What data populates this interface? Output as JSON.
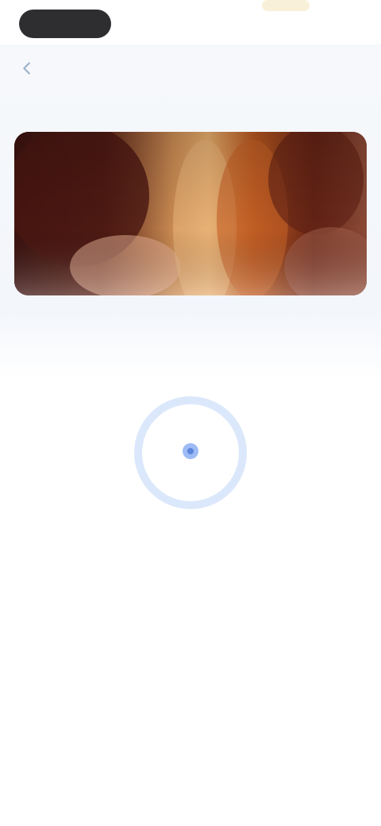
{
  "header": {
    "title": ""
  },
  "banner": {
    "image": "hair-color-photo"
  },
  "caption": {
    "text": ""
  },
  "loader": {
    "label": ""
  },
  "colors": {
    "accent": "#5b8def",
    "ring": "#dbe8fb",
    "title": "#4d5560",
    "muted": "#a8b2c1"
  }
}
